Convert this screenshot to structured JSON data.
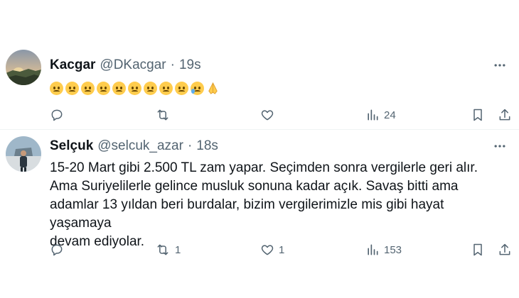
{
  "tweets": [
    {
      "author_name": "Kacgar",
      "handle": "@DKacgar",
      "separator": "·",
      "time": "19s",
      "emojis": [
        "disappointed",
        "disappointed",
        "disappointed",
        "disappointed",
        "disappointed",
        "disappointed",
        "disappointed",
        "worried",
        "slightly-frowning",
        "crying",
        "folded-hands"
      ],
      "stats": {
        "replies": "",
        "retweets": "",
        "likes": "",
        "views": "24"
      }
    },
    {
      "author_name": "Selçuk",
      "handle": "@selcuk_azar",
      "separator": "·",
      "time": "18s",
      "text_lines": [
        "15-20 Mart gibi 2.500 TL zam yapar. Seçimden sonra vergilerle geri alır.",
        "Ama Suriyelilerle gelince musluk sonuna kadar açık. Savaş bitti ama",
        "adamlar 13 yıldan beri burdalar, bizim vergilerimizle mis gibi hayat yaşamaya",
        "devam ediyolar."
      ],
      "stats": {
        "replies": "",
        "retweets": "1",
        "likes": "1",
        "views": "153"
      }
    }
  ],
  "icons": [
    "reply-icon",
    "retweet-icon",
    "like-icon",
    "views-icon",
    "bookmark-icon",
    "share-icon",
    "more-icon"
  ],
  "colors": {
    "text": "#0f1419",
    "secondary": "#536471",
    "divider": "#eff3f4"
  }
}
